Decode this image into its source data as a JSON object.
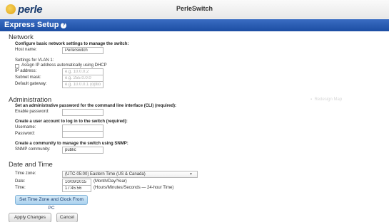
{
  "brand": {
    "logo_text": "perle",
    "device_name": "PerleSwitch"
  },
  "page": {
    "title": "Express Setup"
  },
  "network": {
    "heading": "Network",
    "intro": "Configure basic network settings to manage the switch:",
    "host_label": "Host name:",
    "host_value": "PerleSwitch",
    "vlan_label": "Settings for VLAN 1:",
    "dhcp_label": "Assign IP address automatically using DHCP",
    "dhcp_checked": false,
    "ip_label": "IP address:",
    "ip_placeholder": "e.g. 10.0.0.2",
    "mask_label": "Subnet mask:",
    "mask_placeholder": "e.g. 255.0.0.0",
    "gw_label": "Default gateway:",
    "gw_placeholder": "e.g. 10.0.0.1 (optional)"
  },
  "admin": {
    "heading": "Administration",
    "cli_intro": "Set an administrative password for the command line interface (CLI) (required):",
    "enable_label": "Enable password:",
    "enable_value": "",
    "user_intro": "Create a user account to log in to the switch (required):",
    "username_label": "Username:",
    "username_value": "",
    "password_label": "Password:",
    "password_value": "",
    "snmp_intro": "Create a community to manage the switch using SNMP:",
    "snmp_label": "SNMP community:",
    "snmp_value": "public"
  },
  "datetime": {
    "heading": "Date and Time",
    "tz_label": "Time zone:",
    "tz_value": "(UTC-05:00) Eastern Time (US & Canada)",
    "date_label": "Date:",
    "date_value": "10/09/2015",
    "date_hint": "(Month/Day/Year)",
    "time_label": "Time:",
    "time_value": "17:45:56",
    "time_hint": "(Hours/Minutes/Seconds — 24-hour Time)",
    "set_pc_button": "Set Time Zone and Clock From PC"
  },
  "footer": {
    "apply_button": "Apply Changes",
    "cancel_button": "Cancel"
  },
  "watermark": "Redesign Map"
}
